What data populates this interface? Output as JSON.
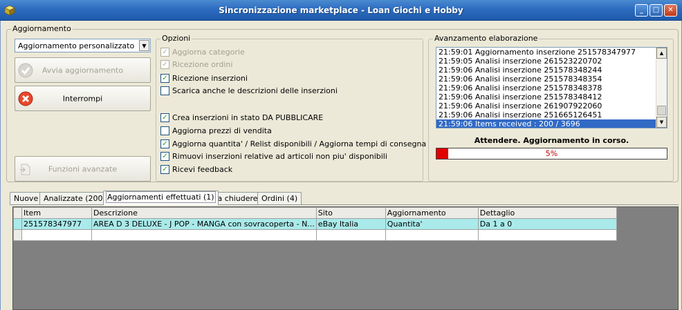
{
  "window": {
    "title": "Sincronizzazione marketplace - Loan Giochi e Hobby",
    "minimize_label": "_",
    "maximize_label": "□",
    "close_label": "✕"
  },
  "aggiornamento": {
    "group_label": "Aggiornamento",
    "combo_value": "Aggiornamento personalizzato",
    "avvia_label": "Avvia aggiornamento",
    "interrompi_label": "Interrompi",
    "funzioni_label": "Funzioni avanzate"
  },
  "opzioni": {
    "group_label": "Opzioni",
    "items": [
      {
        "label": "Aggiorna categorie",
        "checked": true,
        "enabled": false
      },
      {
        "label": "Ricezione ordini",
        "checked": true,
        "enabled": false
      },
      {
        "label": "Ricezione inserzioni",
        "checked": true,
        "enabled": true
      },
      {
        "label": "Scarica anche le descrizioni delle inserzioni",
        "checked": false,
        "enabled": true
      },
      {
        "label": "Crea inserzioni in stato DA PUBBLICARE",
        "checked": true,
        "enabled": true
      },
      {
        "label": "Aggiorna prezzi di vendita",
        "checked": false,
        "enabled": true
      },
      {
        "label": "Aggiorna quantita' / Relist disponibili / Aggiorna tempi di consegna",
        "checked": true,
        "enabled": true
      },
      {
        "label": "Rimuovi inserzioni relative ad articoli non piu' disponibili",
        "checked": true,
        "enabled": true
      },
      {
        "label": "Ricevi feedback",
        "checked": true,
        "enabled": true
      }
    ]
  },
  "avanzamento": {
    "group_label": "Avanzamento elaborazione",
    "log": [
      "21:59:01 Aggiornamento inserzione 251578347977",
      "21:59:05 Analisi inserzione 261523220702",
      "21:59:06 Analisi inserzione 251578348244",
      "21:59:06 Analisi inserzione 251578348354",
      "21:59:06 Analisi inserzione 251578348378",
      "21:59:06 Analisi inserzione 251578348412",
      "21:59:06 Analisi inserzione 261907922060",
      "21:59:06 Analisi inserzione 251665126451",
      "21:59:06 Items received :  200 / 3696"
    ],
    "selected_log_index": 8,
    "status": "Attendere. Aggiornamento in corso.",
    "progress_percent": 5,
    "progress_label": "5%"
  },
  "tabs": [
    {
      "label": "Nuove",
      "active": false
    },
    {
      "label": "Analizzate (200)",
      "active": false
    },
    {
      "label": "Aggiornamenti effettuati (1)",
      "active": true
    },
    {
      "label": "Da chiudere",
      "active": false
    },
    {
      "label": "Ordini (4)",
      "active": false
    }
  ],
  "grid": {
    "columns": [
      "Item",
      "Descrizione",
      "Sito",
      "Aggiornamento",
      "Dettaglio"
    ],
    "rows": [
      [
        "251578347977",
        "AREA D 3 DELUXE - J POP - MANGA con sovracoperta - N...",
        "eBay Italia",
        "Quantita'",
        "Da 1 a 0"
      ]
    ]
  },
  "colors": {
    "title_bar": "#2d6cc0",
    "selection": "#316ac5",
    "progress_fill": "#e00000",
    "selected_row": "#aaeaea"
  }
}
